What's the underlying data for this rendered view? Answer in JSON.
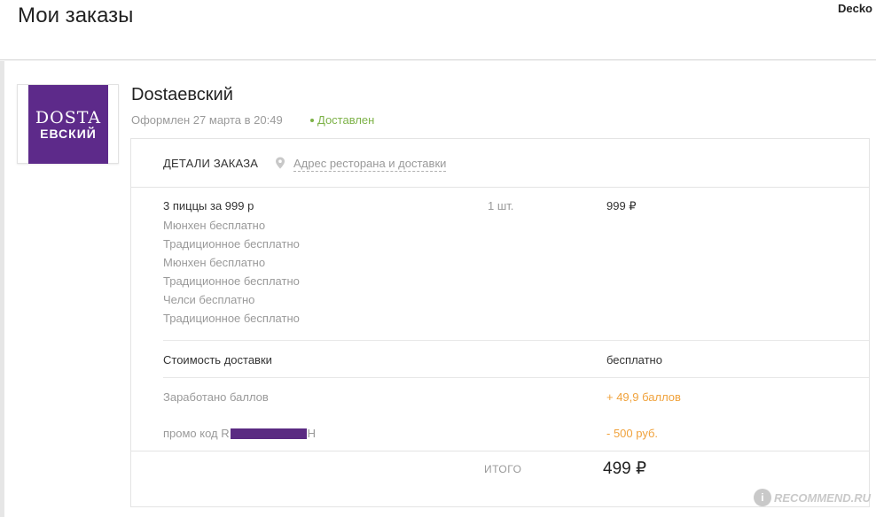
{
  "header": {
    "title": "Мои заказы",
    "corner_watermark": "Decko"
  },
  "order": {
    "logo": {
      "line1": "DOSTA",
      "line2": "ЕВСКИЙ",
      "color": "#5d2a8a"
    },
    "restaurant_name": "Dostaевский",
    "placed_text": "Оформлен 27 марта в 20:49",
    "status": "Доставлен",
    "status_color": "#7db248"
  },
  "panel": {
    "details_tab": "ДЕТАЛИ ЗАКАЗА",
    "address_link": "Адрес ресторана и доставки",
    "address_icon": "location-pin-icon",
    "item": {
      "title": "3 пиццы за 999 р",
      "qty": "1 шт.",
      "price": "999 ₽",
      "subitems": [
        "Мюнхен бесплатно",
        "Традиционное бесплатно",
        "Мюнхен бесплатно",
        "Традиционное бесплатно",
        "Челси бесплатно",
        "Традиционное бесплатно"
      ]
    },
    "delivery": {
      "label": "Стоимость доставки",
      "value": "бесплатно"
    },
    "points": {
      "label": "Заработано баллов",
      "value": "+ 49,9 баллов"
    },
    "promo": {
      "label_prefix": "промо код R",
      "label_suffix": "H",
      "value": "- 500 руб."
    },
    "total": {
      "label": "ИТОГО",
      "value": "499 ₽"
    },
    "accent_orange": "#f0a23c"
  },
  "footer": {
    "watermark_badge": "i",
    "watermark_text": "RECOMMEND.RU"
  }
}
